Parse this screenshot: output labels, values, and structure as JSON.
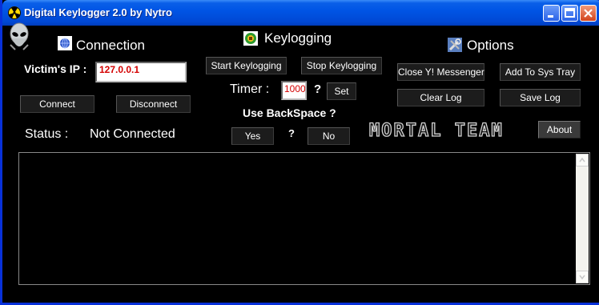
{
  "window": {
    "title": "Digital Keylogger  2.0 by Nytro"
  },
  "connection": {
    "title": "Connection",
    "victim_ip_label": "Victim's IP :",
    "victim_ip_value": "127.0.0.1",
    "connect_label": "Connect",
    "disconnect_label": "Disconnect",
    "status_label": "Status :",
    "status_value": "Not Connected"
  },
  "keylogging": {
    "title": "Keylogging",
    "start_label": "Start Keylogging",
    "stop_label": "Stop Keylogging",
    "timer_label": "Timer :",
    "timer_value": "1000",
    "timer_help": "?",
    "set_label": "Set",
    "backspace_label": "Use BackSpace ?",
    "backspace_help": "?",
    "yes_label": "Yes",
    "no_label": "No"
  },
  "options": {
    "title": "Options",
    "close_messenger_label": "Close Y! Messenger",
    "add_tray_label": "Add To Sys Tray",
    "clear_log_label": "Clear Log",
    "save_log_label": "Save Log",
    "about_label": "About"
  },
  "branding": {
    "team_text": "MORTAL TEAM"
  },
  "log": {
    "content": ""
  },
  "icons": {
    "app": "radiation-icon",
    "alien": "alien-icon",
    "connection": "network-icon",
    "keylogging": "keyboard-icon",
    "options": "tools-icon"
  },
  "colors": {
    "titlebar": "#0055e5",
    "background": "#000000",
    "ip_text": "#d40000"
  }
}
